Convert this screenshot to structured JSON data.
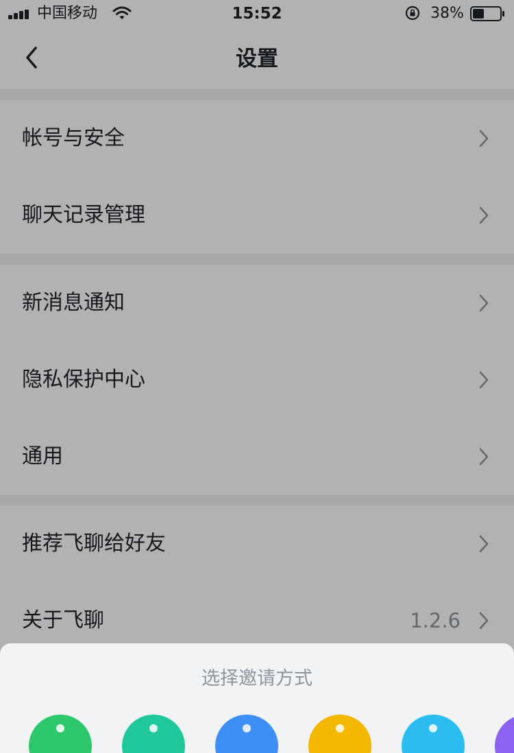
{
  "status_bar": {
    "carrier": "中国移动",
    "time": "15:52",
    "battery": "38%"
  },
  "nav": {
    "title": "设置"
  },
  "settings": {
    "account_security": "帐号与安全",
    "chat_history": "聊天记录管理",
    "new_message_notify": "新消息通知",
    "privacy_center": "隐私保护中心",
    "general": "通用",
    "recommend": "推荐飞聊给好友",
    "about": "关于飞聊",
    "version": "1.2.6"
  },
  "invite_sheet": {
    "title": "选择邀请方式",
    "option_colors": [
      "#2dc86b",
      "#1fc79a",
      "#3e8ff5",
      "#f5b800",
      "#2bbcf0",
      "#8a63f0"
    ]
  },
  "colors": {
    "overlay": "rgba(0,0,0,0.30)",
    "secondary_text": "#8f959e",
    "separator_bg": "#f1f2f4"
  }
}
